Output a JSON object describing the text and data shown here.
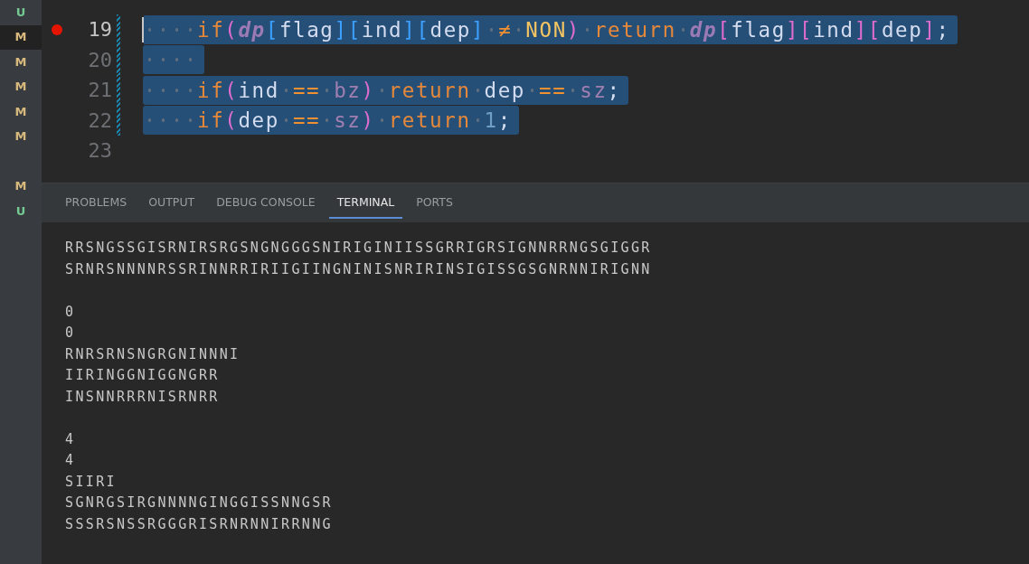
{
  "scm_strip": {
    "groups": [
      [
        {
          "status": "U",
          "selected": false
        },
        {
          "status": "M",
          "selected": true
        },
        {
          "status": "M",
          "selected": false
        },
        {
          "status": "M",
          "selected": false
        },
        {
          "status": "M",
          "selected": false
        },
        {
          "status": "M",
          "selected": false
        }
      ],
      [
        {
          "status": "M",
          "selected": false
        },
        {
          "status": "U",
          "selected": false
        }
      ]
    ]
  },
  "editor": {
    "lines": [
      {
        "number": "19",
        "current": true,
        "breakpoint": true,
        "changed": true,
        "selected": true,
        "indented": true,
        "words": [
          [
            {
              "text": "if",
              "kind": "keyword"
            },
            {
              "text": "(",
              "kind": "paren"
            },
            {
              "text": "dp",
              "kind": "array"
            },
            {
              "text": "[",
              "kind": "bracket"
            },
            {
              "text": "flag",
              "kind": "ident"
            },
            {
              "text": "]",
              "kind": "bracket"
            },
            {
              "text": "[",
              "kind": "bracket"
            },
            {
              "text": "ind",
              "kind": "ident"
            },
            {
              "text": "]",
              "kind": "bracket"
            },
            {
              "text": "[",
              "kind": "bracket"
            },
            {
              "text": "dep",
              "kind": "ident"
            },
            {
              "text": "]",
              "kind": "bracket"
            }
          ],
          [
            {
              "text": "≠",
              "kind": "operator"
            }
          ],
          [
            {
              "text": "NON",
              "kind": "constant"
            },
            {
              "text": ")",
              "kind": "paren"
            }
          ],
          [
            {
              "text": "return",
              "kind": "keyword"
            }
          ],
          [
            {
              "text": "dp",
              "kind": "array"
            },
            {
              "text": "[",
              "kind": "paren"
            },
            {
              "text": "flag",
              "kind": "ident"
            },
            {
              "text": "]",
              "kind": "paren"
            },
            {
              "text": "[",
              "kind": "paren"
            },
            {
              "text": "ind",
              "kind": "ident"
            },
            {
              "text": "]",
              "kind": "paren"
            },
            {
              "text": "[",
              "kind": "paren"
            },
            {
              "text": "dep",
              "kind": "ident"
            },
            {
              "text": "]",
              "kind": "paren"
            },
            {
              "text": ";",
              "kind": "ident"
            }
          ]
        ]
      },
      {
        "number": "20",
        "current": false,
        "breakpoint": false,
        "changed": true,
        "selected": true,
        "indented": true
      },
      {
        "number": "21",
        "current": false,
        "breakpoint": false,
        "changed": true,
        "selected": true,
        "indented": true,
        "words": [
          [
            {
              "text": "if",
              "kind": "keyword"
            },
            {
              "text": "(",
              "kind": "paren"
            },
            {
              "text": "ind",
              "kind": "ident"
            }
          ],
          [
            {
              "text": "==",
              "kind": "operator"
            }
          ],
          [
            {
              "text": "bz",
              "kind": "member"
            },
            {
              "text": ")",
              "kind": "paren"
            }
          ],
          [
            {
              "text": "return",
              "kind": "keyword"
            }
          ],
          [
            {
              "text": "dep",
              "kind": "ident"
            }
          ],
          [
            {
              "text": "==",
              "kind": "operator"
            }
          ],
          [
            {
              "text": "sz",
              "kind": "member"
            },
            {
              "text": ";",
              "kind": "ident"
            }
          ]
        ]
      },
      {
        "number": "22",
        "current": false,
        "breakpoint": false,
        "changed": true,
        "selected": true,
        "indented": true,
        "words": [
          [
            {
              "text": "if",
              "kind": "keyword"
            },
            {
              "text": "(",
              "kind": "paren"
            },
            {
              "text": "dep",
              "kind": "ident"
            }
          ],
          [
            {
              "text": "==",
              "kind": "operator"
            }
          ],
          [
            {
              "text": "sz",
              "kind": "member"
            },
            {
              "text": ")",
              "kind": "paren"
            }
          ],
          [
            {
              "text": "return",
              "kind": "keyword"
            }
          ],
          [
            {
              "text": "1",
              "kind": "number"
            },
            {
              "text": ";",
              "kind": "ident"
            }
          ]
        ]
      },
      {
        "number": "23",
        "current": false,
        "breakpoint": false,
        "changed": false,
        "selected": false,
        "indented": false
      }
    ]
  },
  "panel": {
    "tabs": [
      {
        "label": "PROBLEMS",
        "selected": false
      },
      {
        "label": "OUTPUT",
        "selected": false
      },
      {
        "label": "DEBUG CONSOLE",
        "selected": false
      },
      {
        "label": "TERMINAL",
        "selected": true
      },
      {
        "label": "PORTS",
        "selected": false
      }
    ],
    "terminal_blocks": [
      [
        "RRSNGSSGISRNIRSRGSNGNGGGSNIRIGINIISSGRRIGRSIGNNRRNGSGIGGR",
        "SRNRSNNNNRSSRINNRRIRIIGIINGNINISNRIRINSIGISSGSGNRNNIRIGNN"
      ],
      [
        "0",
        "0",
        "RNRSRNSNGRGNINNNI",
        "IIRINGGNIGGNGRR",
        "INSNNRRRNISRNRR"
      ],
      [
        "4",
        "4",
        "SIIRI",
        "SGNRGSIRGNNNNGINGGISSNNGSR",
        "SSSRSNSSRGGGRISRNRNNIRRNNG"
      ]
    ]
  }
}
